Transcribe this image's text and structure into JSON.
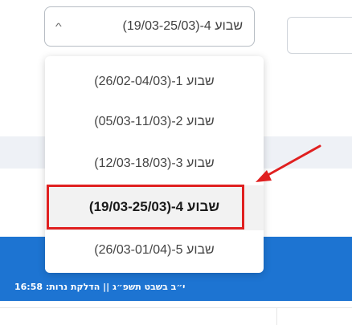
{
  "select": {
    "value": "שבוע 4-(19/03-25/03)",
    "chevron": "chevron-up-icon"
  },
  "dropdown": {
    "options": [
      "שבוע 1-(26/02-04/03)",
      "שבוע 2-(05/03-11/03)",
      "שבוע 3-(12/03-18/03)",
      "שבוע 4-(19/03-25/03)",
      "שבוע 5-(26/03-01/04)"
    ],
    "selected_index": 3
  },
  "banner": {
    "text": "י״ב בשבט תשפ״ג || הדלקת נרות: 16:58"
  },
  "colors": {
    "accent": "#e02020",
    "banner": "#1d74d2"
  }
}
